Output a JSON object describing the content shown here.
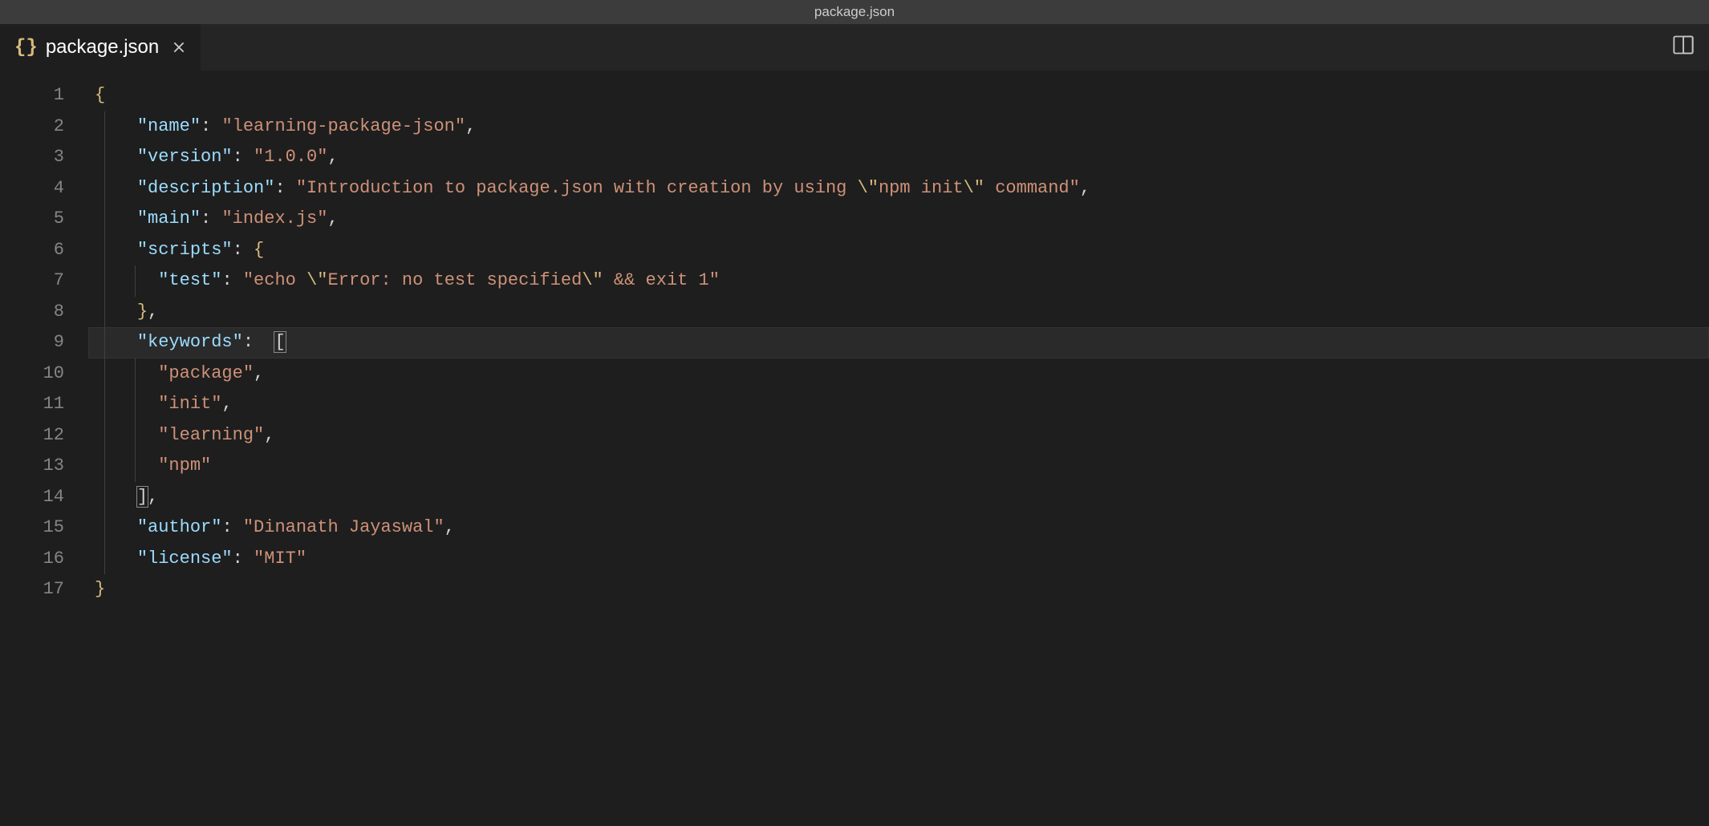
{
  "window": {
    "title": "package.json"
  },
  "tab": {
    "filename": "package.json"
  },
  "editor": {
    "active_line": 9,
    "line_numbers": [
      "1",
      "2",
      "3",
      "4",
      "5",
      "6",
      "7",
      "8",
      "9",
      "10",
      "11",
      "12",
      "13",
      "14",
      "15",
      "16",
      "17"
    ],
    "lines": [
      [
        {
          "t": "brace",
          "v": "{"
        }
      ],
      [
        {
          "t": "sp",
          "v": "    "
        },
        {
          "t": "key",
          "v": "\"name\""
        },
        {
          "t": "punc",
          "v": ": "
        },
        {
          "t": "str",
          "v": "\"learning-package-json\""
        },
        {
          "t": "punc",
          "v": ","
        }
      ],
      [
        {
          "t": "sp",
          "v": "    "
        },
        {
          "t": "key",
          "v": "\"version\""
        },
        {
          "t": "punc",
          "v": ": "
        },
        {
          "t": "str",
          "v": "\"1.0.0\""
        },
        {
          "t": "punc",
          "v": ","
        }
      ],
      [
        {
          "t": "sp",
          "v": "    "
        },
        {
          "t": "key",
          "v": "\"description\""
        },
        {
          "t": "punc",
          "v": ": "
        },
        {
          "t": "str",
          "v": "\"Introduction to package.json with creation by using "
        },
        {
          "t": "esc",
          "v": "\\\""
        },
        {
          "t": "str",
          "v": "npm init"
        },
        {
          "t": "esc",
          "v": "\\\""
        },
        {
          "t": "str",
          "v": " command\""
        },
        {
          "t": "punc",
          "v": ","
        }
      ],
      [
        {
          "t": "sp",
          "v": "    "
        },
        {
          "t": "key",
          "v": "\"main\""
        },
        {
          "t": "punc",
          "v": ": "
        },
        {
          "t": "str",
          "v": "\"index.js\""
        },
        {
          "t": "punc",
          "v": ","
        }
      ],
      [
        {
          "t": "sp",
          "v": "    "
        },
        {
          "t": "key",
          "v": "\"scripts\""
        },
        {
          "t": "punc",
          "v": ": "
        },
        {
          "t": "brace",
          "v": "{"
        }
      ],
      [
        {
          "t": "sp",
          "v": "      "
        },
        {
          "t": "key",
          "v": "\"test\""
        },
        {
          "t": "punc",
          "v": ": "
        },
        {
          "t": "str",
          "v": "\"echo "
        },
        {
          "t": "esc",
          "v": "\\\""
        },
        {
          "t": "str",
          "v": "Error: no test specified"
        },
        {
          "t": "esc",
          "v": "\\\""
        },
        {
          "t": "str",
          "v": " && exit 1\""
        }
      ],
      [
        {
          "t": "sp",
          "v": "    "
        },
        {
          "t": "brace",
          "v": "}"
        },
        {
          "t": "punc",
          "v": ","
        }
      ],
      [
        {
          "t": "sp",
          "v": "    "
        },
        {
          "t": "key",
          "v": "\"keywords\""
        },
        {
          "t": "punc",
          "v": ":  "
        },
        {
          "t": "bracket-match",
          "v": "["
        }
      ],
      [
        {
          "t": "sp",
          "v": "      "
        },
        {
          "t": "str",
          "v": "\"package\""
        },
        {
          "t": "punc",
          "v": ","
        }
      ],
      [
        {
          "t": "sp",
          "v": "      "
        },
        {
          "t": "str",
          "v": "\"init\""
        },
        {
          "t": "punc",
          "v": ","
        }
      ],
      [
        {
          "t": "sp",
          "v": "      "
        },
        {
          "t": "str",
          "v": "\"learning\""
        },
        {
          "t": "punc",
          "v": ","
        }
      ],
      [
        {
          "t": "sp",
          "v": "      "
        },
        {
          "t": "str",
          "v": "\"npm\""
        }
      ],
      [
        {
          "t": "sp",
          "v": "    "
        },
        {
          "t": "bracket-match",
          "v": "]"
        },
        {
          "t": "punc",
          "v": ","
        }
      ],
      [
        {
          "t": "sp",
          "v": "    "
        },
        {
          "t": "key",
          "v": "\"author\""
        },
        {
          "t": "punc",
          "v": ": "
        },
        {
          "t": "str",
          "v": "\"Dinanath Jayaswal\""
        },
        {
          "t": "punc",
          "v": ","
        }
      ],
      [
        {
          "t": "sp",
          "v": "    "
        },
        {
          "t": "key",
          "v": "\"license\""
        },
        {
          "t": "punc",
          "v": ": "
        },
        {
          "t": "str",
          "v": "\"MIT\""
        }
      ],
      [
        {
          "t": "brace",
          "v": "}"
        }
      ]
    ]
  },
  "file_content": {
    "name": "learning-package-json",
    "version": "1.0.0",
    "description": "Introduction to package.json with creation by using \"npm init\" command",
    "main": "index.js",
    "scripts": {
      "test": "echo \"Error: no test specified\" && exit 1"
    },
    "keywords": [
      "package",
      "init",
      "learning",
      "npm"
    ],
    "author": "Dinanath Jayaswal",
    "license": "MIT"
  }
}
